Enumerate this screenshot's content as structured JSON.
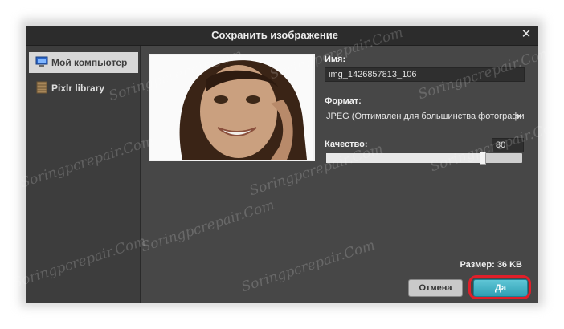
{
  "dialog": {
    "title": "Сохранить изображение",
    "close_glyph": "✕"
  },
  "sidebar": {
    "items": [
      {
        "label": "Мой компьютер",
        "icon": "computer-icon",
        "active": true
      },
      {
        "label": "Pixlr library",
        "icon": "library-icon",
        "active": false
      }
    ]
  },
  "form": {
    "name_label": "Имя:",
    "name_value": "img_1426857813_106",
    "format_label": "Формат:",
    "format_value": "JPEG (Оптимален для большинства фотографий)",
    "quality_label": "Качество:",
    "quality_value": "80",
    "quality_level": 0.8
  },
  "footer": {
    "size_text": "Размер: 36 KB",
    "cancel_label": "Отмена",
    "ok_label": "Да"
  },
  "watermark": {
    "text": "Soringpcrepair.Com"
  },
  "colors": {
    "dialog_bg": "#474747",
    "titlebar_bg": "#2c2c2c",
    "accent": "#3aaec2",
    "highlight": "#e01f2a"
  }
}
